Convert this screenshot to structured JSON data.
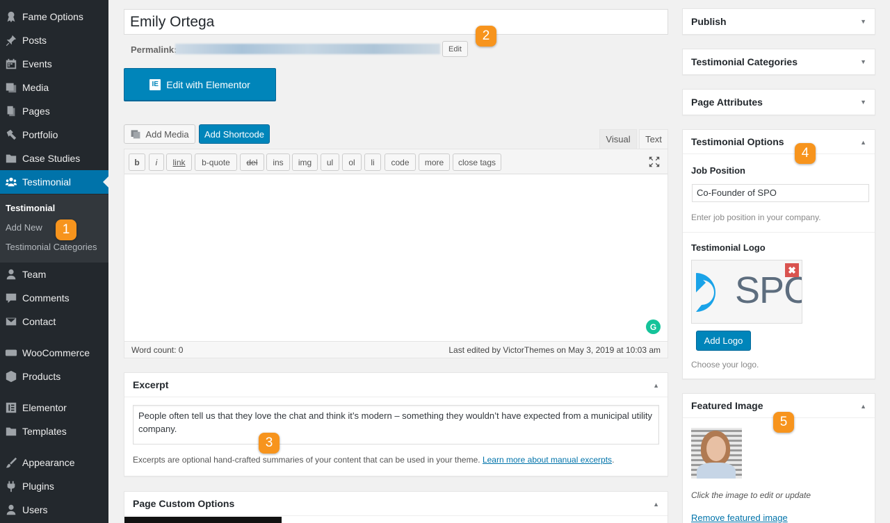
{
  "sidebar": {
    "items": [
      {
        "label": "Fame Options",
        "icon": "award-icon"
      },
      {
        "label": "Posts",
        "icon": "pin-icon"
      },
      {
        "label": "Events",
        "icon": "calendar-icon"
      },
      {
        "label": "Media",
        "icon": "media-icon"
      },
      {
        "label": "Pages",
        "icon": "pages-icon"
      },
      {
        "label": "Portfolio",
        "icon": "hammer-icon"
      },
      {
        "label": "Case Studies",
        "icon": "folder-icon"
      },
      {
        "label": "Testimonial",
        "icon": "people-icon"
      },
      {
        "label": "Team",
        "icon": "person-icon"
      },
      {
        "label": "Comments",
        "icon": "comment-icon"
      },
      {
        "label": "Contact",
        "icon": "mail-icon"
      },
      {
        "label": "WooCommerce",
        "icon": "woo-icon"
      },
      {
        "label": "Products",
        "icon": "box-icon"
      },
      {
        "label": "Elementor",
        "icon": "elementor-icon"
      },
      {
        "label": "Templates",
        "icon": "folder-icon"
      },
      {
        "label": "Appearance",
        "icon": "brush-icon"
      },
      {
        "label": "Plugins",
        "icon": "plug-icon"
      },
      {
        "label": "Users",
        "icon": "user-icon"
      }
    ],
    "submenu": [
      "Testimonial",
      "Add New",
      "Testimonial Categories"
    ]
  },
  "badges": [
    "1",
    "2",
    "3",
    "4",
    "5"
  ],
  "post": {
    "title": "Emily Ortega",
    "permalink_label": "Permalink:",
    "permalink_edit": "Edit",
    "elementor_button": "Edit with Elementor",
    "elementor_icon": "IE"
  },
  "editor": {
    "add_media": "Add Media",
    "add_shortcode": "Add Shortcode",
    "tab_visual": "Visual",
    "tab_text": "Text",
    "quicktags": [
      "b",
      "i",
      "link",
      "b-quote",
      "del",
      "ins",
      "img",
      "ul",
      "ol",
      "li",
      "code",
      "more",
      "close tags"
    ],
    "word_count": "Word count: 0",
    "last_edited": "Last edited by VictorThemes on May 3, 2019 at 10:03 am",
    "grammarly": "G"
  },
  "excerpt": {
    "title": "Excerpt",
    "text": "People often tell us that they love the chat and think it’s modern – something they wouldn’t have expected from a municipal utility company.",
    "help": "Excerpts are optional hand-crafted summaries of your content that can be used in your theme.",
    "help_link": "Learn more about manual excerpts",
    "help_end": "."
  },
  "custom_options": {
    "title": "Page Custom Options"
  },
  "right": {
    "publish": "Publish",
    "categories": "Testimonial Categories",
    "attributes": "Page Attributes",
    "options_title": "Testimonial Options",
    "job_label": "Job Position",
    "job_value": "Co-Founder of SPO",
    "job_hint": "Enter job position in your company.",
    "logo_label": "Testimonial Logo",
    "logo_text": "SPC",
    "add_logo": "Add Logo",
    "logo_hint": "Choose your logo.",
    "featured_title": "Featured Image",
    "featured_hint": "Click the image to edit or update",
    "remove_featured": "Remove featured image"
  },
  "colors": {
    "accent": "#0073aa",
    "button": "#0085ba",
    "badge": "#f7941d",
    "sidebar": "#23282d"
  }
}
